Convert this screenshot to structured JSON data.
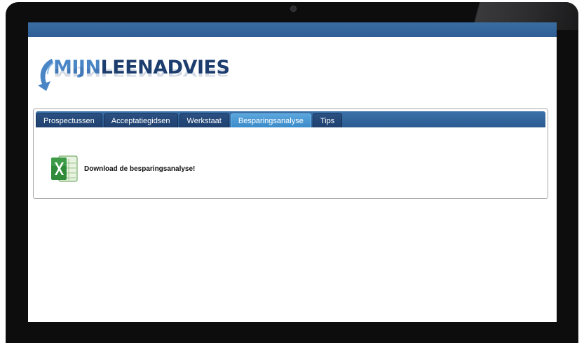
{
  "logo": {
    "part1": "MIJN",
    "part2": "LEENADVIES",
    "reflection": "MIJNLEENADVIES",
    "icon": "curved-arrow-icon"
  },
  "tabs": [
    {
      "label": "Prospectussen",
      "active": false
    },
    {
      "label": "Acceptatiegidsen",
      "active": false
    },
    {
      "label": "Werkstaat",
      "active": false
    },
    {
      "label": "Besparingsanalyse",
      "active": true
    },
    {
      "label": "Tips",
      "active": false
    }
  ],
  "content": {
    "download_label": "Download de besparingsanalyse!",
    "icon": "excel-icon"
  },
  "colors": {
    "top_bar": "#2f5e94",
    "tab_strip": "#2a5b91",
    "active_tab": "#3b8bc9",
    "logo_light": "#4a86c5",
    "logo_dark": "#1c3d6e"
  }
}
